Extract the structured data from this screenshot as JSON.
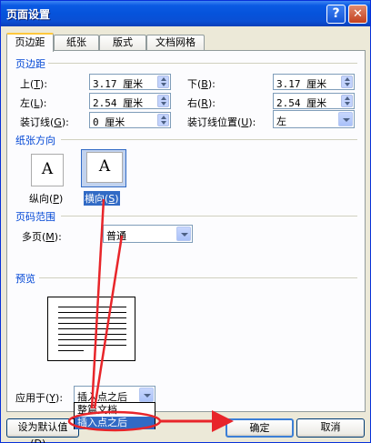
{
  "window": {
    "title": "页面设置",
    "help": "?",
    "close": "✕"
  },
  "tabs": [
    "页边距",
    "纸张",
    "版式",
    "文档网格"
  ],
  "margins": {
    "section": "页边距",
    "top": {
      "label": "上",
      "key": "T",
      "value": "3.17 厘米"
    },
    "bottom": {
      "label": "下",
      "key": "B",
      "value": "3.17 厘米"
    },
    "left": {
      "label": "左",
      "key": "L",
      "value": "2.54 厘米"
    },
    "right": {
      "label": "右",
      "key": "R",
      "value": "2.54 厘米"
    },
    "gutter": {
      "label": "装订线",
      "key": "G",
      "value": "0 厘米"
    },
    "gutter_pos": {
      "label": "装订线位置",
      "key": "U",
      "value": "左"
    }
  },
  "orientation": {
    "section": "纸张方向",
    "portrait": {
      "label": "纵向",
      "key": "P",
      "glyph": "A"
    },
    "landscape": {
      "label": "横向",
      "key": "S",
      "glyph": "A"
    }
  },
  "pages": {
    "section": "页码范围",
    "multi_label": "多页",
    "multi_key": "M",
    "multi_value": "普通"
  },
  "preview": {
    "section": "预览"
  },
  "apply": {
    "label": "应用于",
    "key": "Y",
    "value": "插入点之后",
    "options": [
      "整篇文档",
      "插入点之后"
    ]
  },
  "buttons": {
    "default": "设为默认值",
    "default_key": "D",
    "ok": "确定",
    "cancel": "取消"
  },
  "colors": {
    "annotation": "#e8252a",
    "accent": "#0046d5"
  }
}
